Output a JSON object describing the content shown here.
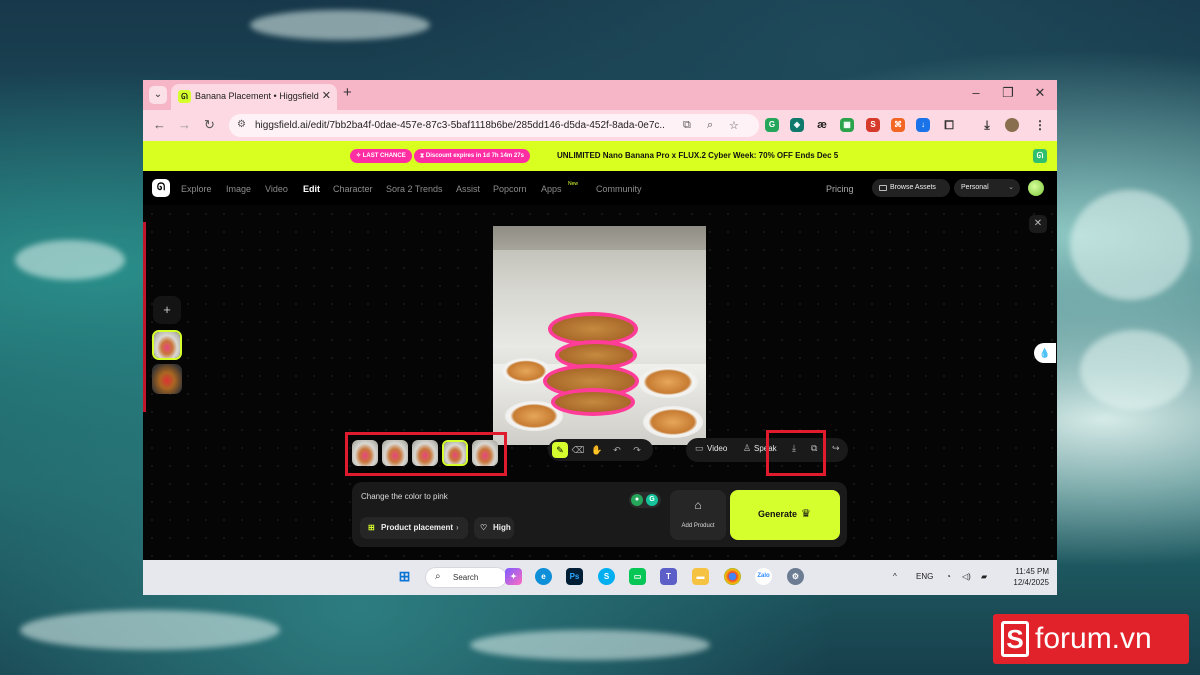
{
  "browser": {
    "tab_title": "Banana Placement • Higgsfield",
    "tab_close": "✕",
    "new_tab": "+",
    "url": "higgsfield.ai/edit/7bb2ba4f-0dae-457e-87c3-5baf1118b6be/285dd146-d5da-452f-8ada-0e7c...",
    "window_controls": [
      "–",
      "❐",
      "✕"
    ]
  },
  "promo": {
    "pill_1": "✧ LAST CHANCE",
    "pill_2": "⧗ Discount expires in 1d 7h 14m 27s",
    "text": "UNLIMITED Nano Banana Pro x FLUX.2 Cyber Week: 70% OFF Ends Dec 5"
  },
  "nav": {
    "items": [
      "Explore",
      "Image",
      "Video",
      "Edit",
      "Character",
      "Sora 2 Trends",
      "Assist",
      "Popcorn",
      "Apps",
      "Community"
    ],
    "apps_badge": "New",
    "pricing": "Pricing",
    "browse_assets": "Browse Assets",
    "workspace": "Personal"
  },
  "editor": {
    "add_button": "+",
    "close": "✕",
    "actions": {
      "video": "Video",
      "speak": "Speak"
    }
  },
  "prompt": {
    "text": "Change the color to pink",
    "product_chip": "Product placement",
    "quality_chip": "High",
    "add_product": "Add Product",
    "generate": "Generate"
  },
  "taskbar": {
    "search": "Search",
    "language": "ENG",
    "time": "11:45 PM",
    "date": "12/4/2025"
  },
  "watermark": {
    "text": "forum.vn",
    "letter": "S"
  },
  "colors": {
    "accent": "#d6ff2e",
    "pink": "#ff2fa3",
    "highlight_box": "#e01b2d",
    "tab_bar": "#f6b6c8"
  }
}
